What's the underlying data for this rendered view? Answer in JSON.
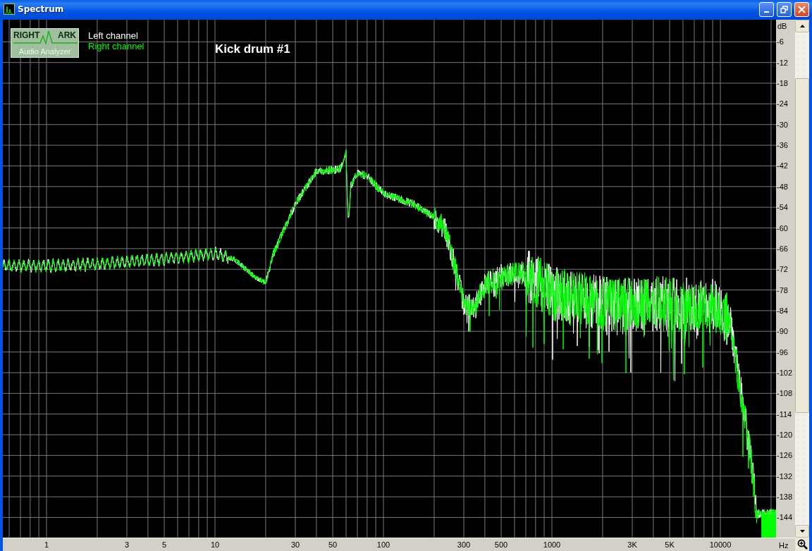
{
  "window": {
    "title": "Spectrum"
  },
  "logo": {
    "top_left": "RIGHT",
    "top_right": "ARK",
    "bottom": "Audio Analyzer"
  },
  "legend": [
    {
      "label": "Left channel",
      "color": "#ffffff"
    },
    {
      "label": "Right channel",
      "color": "#00ff00"
    }
  ],
  "chart_title": "Kick drum #1",
  "y_axis": {
    "unit": "dB",
    "ticks": [
      "-6",
      "-12",
      "-18",
      "-24",
      "-30",
      "-36",
      "-42",
      "-48",
      "-54",
      "-60",
      "-66",
      "-72",
      "-78",
      "-84",
      "-90",
      "-96",
      "-102",
      "-108",
      "-114",
      "-120",
      "-126",
      "-132",
      "-138",
      "-144"
    ]
  },
  "x_axis": {
    "unit": "Hz",
    "ticks": [
      "1",
      "3",
      "5",
      "10",
      "30",
      "50",
      "100",
      "300",
      "500",
      "1000",
      "3K",
      "5K",
      "10000"
    ]
  }
}
